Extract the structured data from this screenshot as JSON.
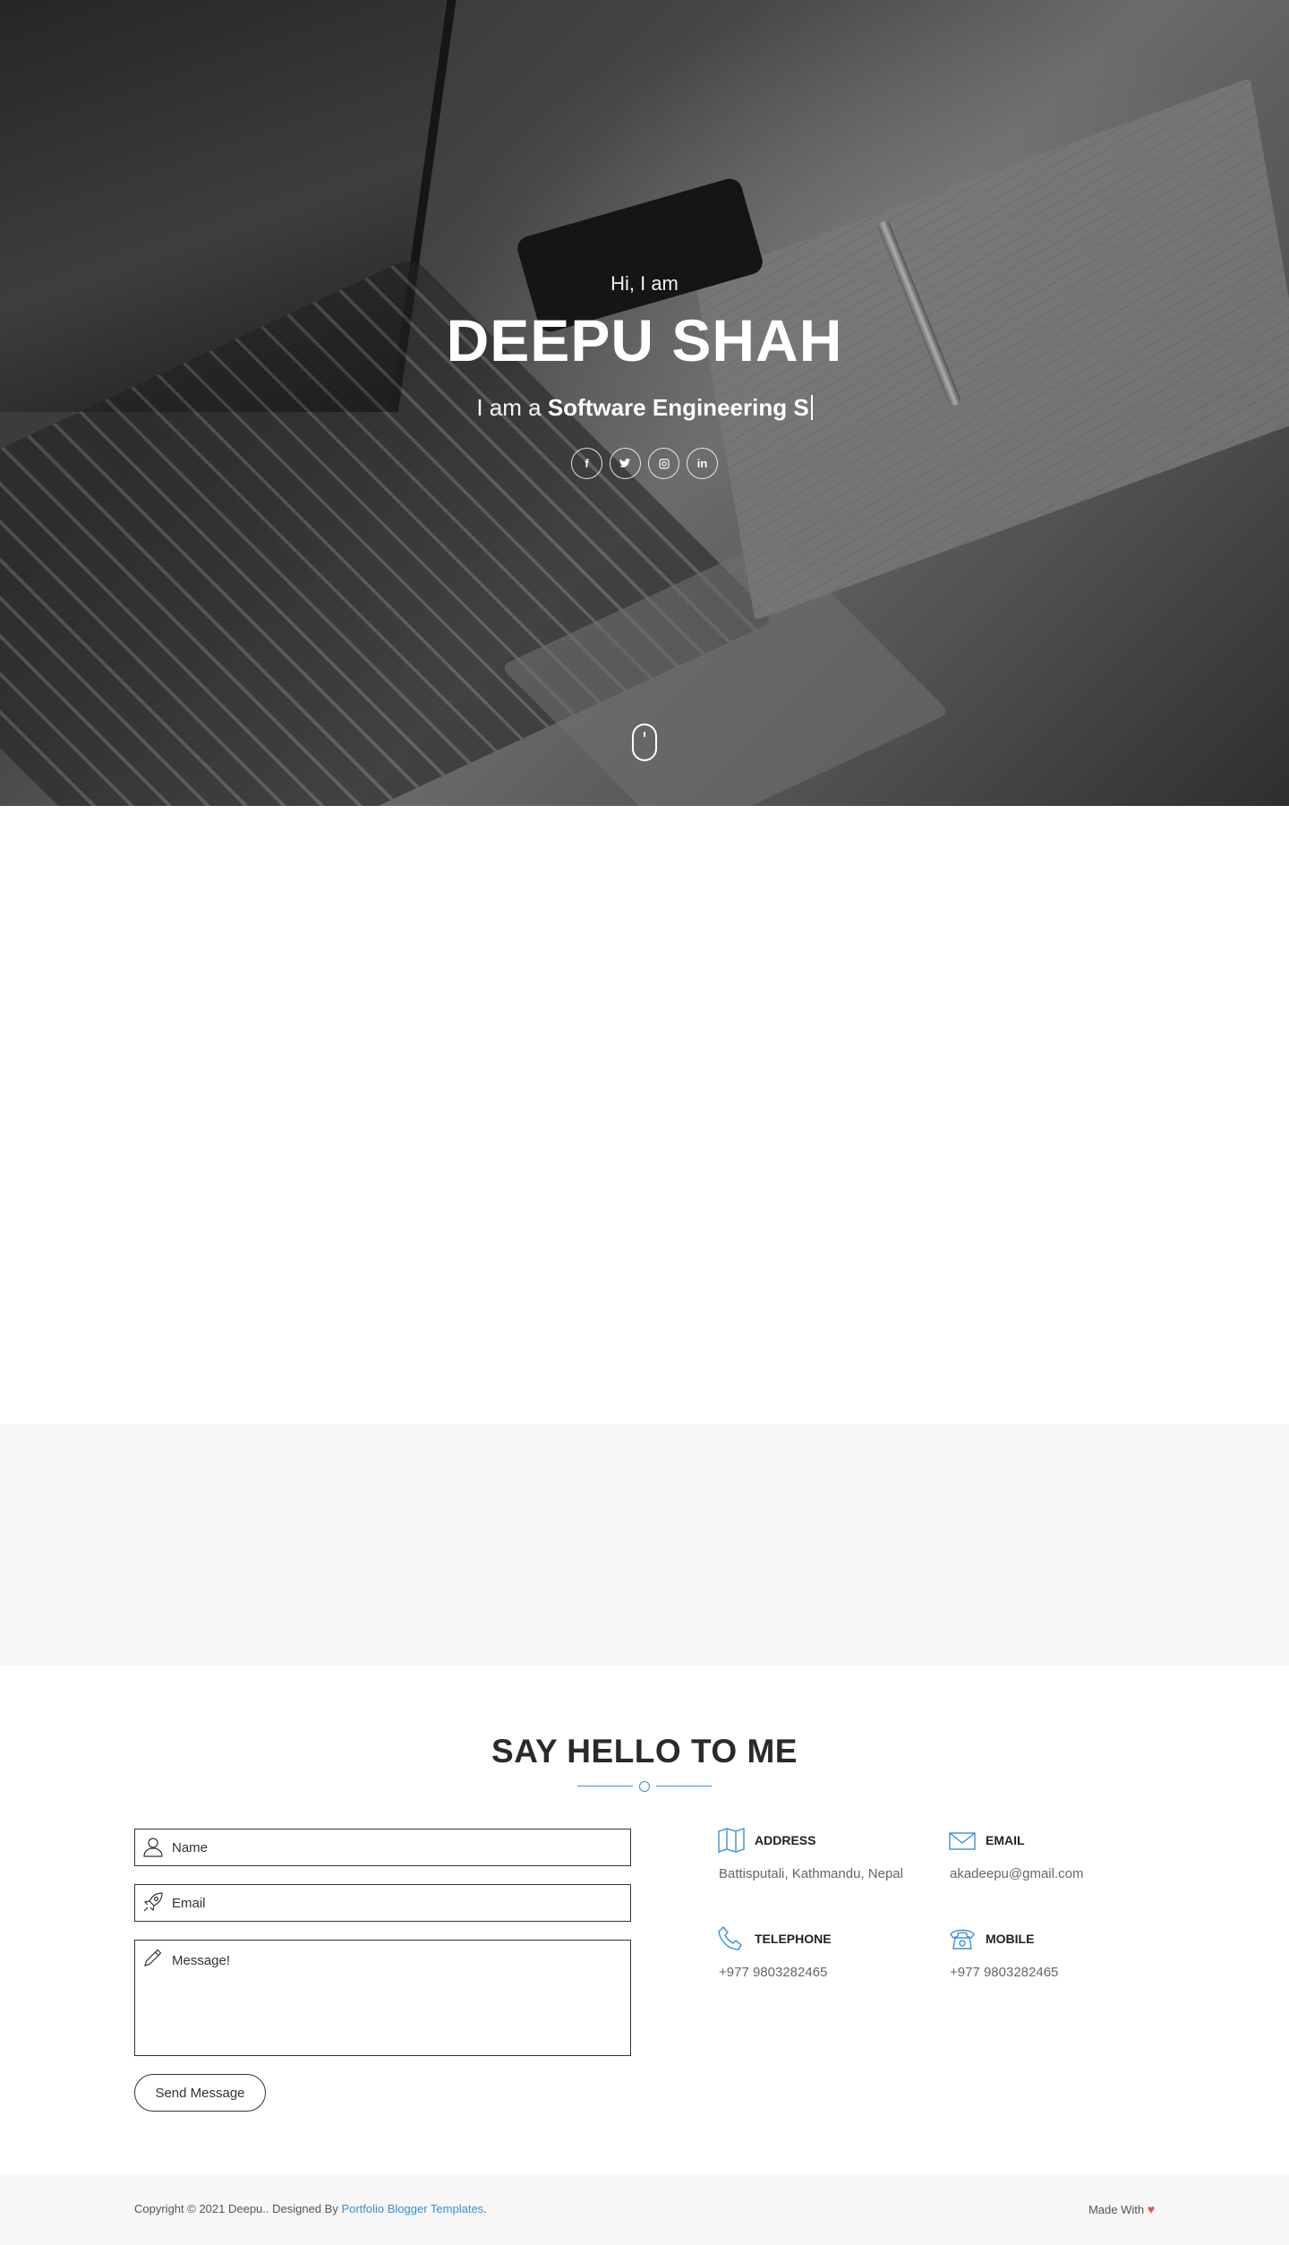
{
  "hero": {
    "greeting": "Hi, I am",
    "name": "DEEPU SHAH",
    "tagline_prefix": "I am a ",
    "tagline_role": "Software Engineering S",
    "social_links": [
      {
        "icon": "facebook-icon",
        "glyph": "f"
      },
      {
        "icon": "twitter-icon",
        "glyph": "t"
      },
      {
        "icon": "instagram-icon",
        "glyph": "◎"
      },
      {
        "icon": "linkedin-icon",
        "glyph": "in"
      }
    ],
    "scroll_icon": "mouse-scroll-icon"
  },
  "contact": {
    "title": "SAY HELLO TO ME",
    "form": {
      "name_placeholder": "Name",
      "email_placeholder": "Email",
      "message_placeholder": "Message!",
      "send_label": "Send Message"
    },
    "info": {
      "address": {
        "label": "ADDRESS",
        "value": "Battisputali, Kathmandu, Nepal",
        "icon": "map-icon"
      },
      "email": {
        "label": "EMAIL",
        "value": "akadeepu@gmail.com",
        "icon": "envelope-icon"
      },
      "telephone": {
        "label": "TELEPHONE",
        "value": "+977 9803282465",
        "icon": "phone-icon"
      },
      "mobile": {
        "label": "MOBILE",
        "value": "+977 9803282465",
        "icon": "telephone-icon"
      }
    },
    "accent_color": "#3a8fd6"
  },
  "footer": {
    "copyright_text": "Copyright © 2021 Deepu.. Designed By ",
    "designer_link": "Portfolio Blogger Templates",
    "copyright_end": ".",
    "made_with": "Made With "
  }
}
